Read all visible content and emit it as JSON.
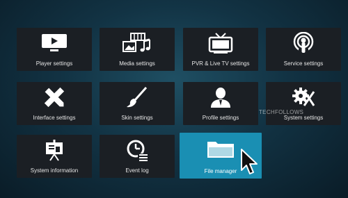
{
  "tiles": [
    {
      "label": "Player settings",
      "icon": "monitor-play-icon"
    },
    {
      "label": "Media settings",
      "icon": "media-icon"
    },
    {
      "label": "PVR & Live TV settings",
      "icon": "tv-icon"
    },
    {
      "label": "Service settings",
      "icon": "podcast-icon"
    },
    {
      "label": "Interface settings",
      "icon": "pencil-ruler-icon"
    },
    {
      "label": "Skin settings",
      "icon": "paintbrush-icon"
    },
    {
      "label": "Profile settings",
      "icon": "user-icon"
    },
    {
      "label": "System settings",
      "icon": "gear-tools-icon"
    },
    {
      "label": "System information",
      "icon": "presentation-icon"
    },
    {
      "label": "Event log",
      "icon": "clock-list-icon"
    },
    {
      "label": "File manager",
      "icon": "folder-icon"
    }
  ],
  "selected_tile": "File manager",
  "watermark": "TECHFOLLOWS",
  "colors": {
    "tile": "#1b1f24",
    "selected": "#1a8fb3",
    "text": "#e6e6e6"
  }
}
